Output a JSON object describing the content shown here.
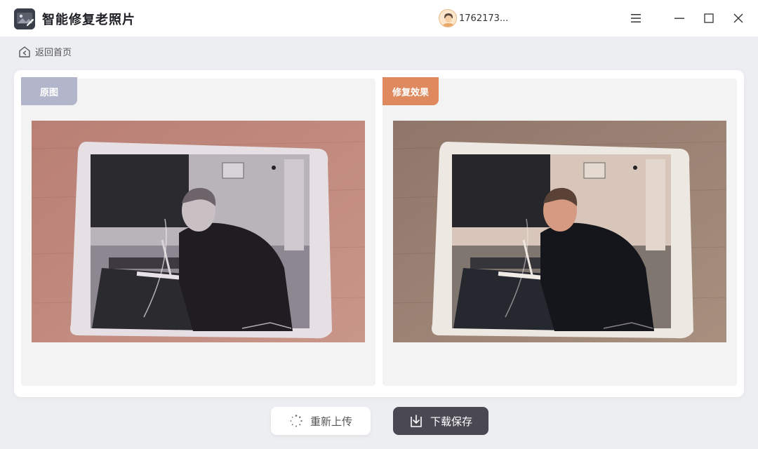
{
  "app": {
    "title": "智能修复老照片",
    "user": "1762173..."
  },
  "nav": {
    "back_label": "返回首页"
  },
  "panels": {
    "original_label": "原图",
    "restored_label": "修复效果"
  },
  "actions": {
    "reupload_label": "重新上传",
    "download_label": "下载保存"
  },
  "icons": {
    "logo": "photo-wand-icon",
    "avatar": "user-avatar-icon",
    "menu": "hamburger-menu-icon",
    "minimize": "minimize-icon",
    "maximize": "maximize-icon",
    "close": "close-icon",
    "back": "home-back-icon",
    "reupload": "refresh-icon",
    "download": "download-icon"
  },
  "colors": {
    "original_tag": "#b3b6cb",
    "restored_tag": "#df8a5e",
    "download_button": "#4a4953"
  }
}
